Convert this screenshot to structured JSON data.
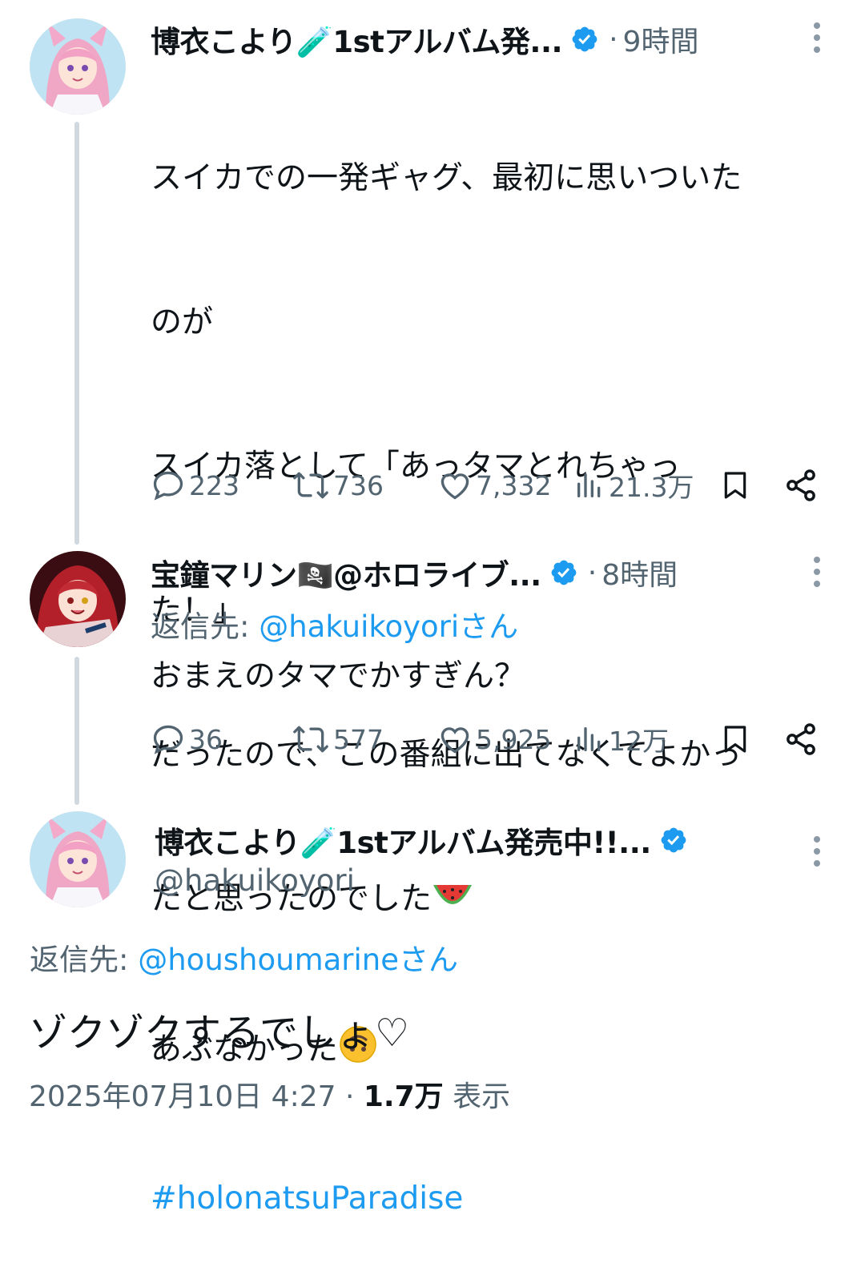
{
  "tweet1": {
    "name": "博衣こより🧪1stアルバム発...",
    "time": "9時間",
    "lines": [
      "スイカでの一発ギャグ、最初に思いついた",
      "のが",
      "スイカ落として「あっタマとれちゃっ",
      "た！」",
      "だったので、この番組に出てなくてよかっ",
      "たと思ったのでした",
      "あぶなかった"
    ],
    "emoji_after_line6": "watermelon-emoji",
    "emoji_after_line7": "upside-down-face-emoji",
    "hashtag": "#holonatsuParadise",
    "replies": "223",
    "retweets": "736",
    "likes": "7,332",
    "views": "21.3万"
  },
  "tweet2": {
    "name": "宝鐘マリン🏴‍☠️@ホロライブ...",
    "time": "8時間",
    "reply_label": "返信先: ",
    "reply_mention": "@hakuikoyori",
    "reply_suffix": "さん",
    "text": "おまえのタマでかすぎん？",
    "replies": "36",
    "retweets": "577",
    "likes": "5,925",
    "views": "12万"
  },
  "tweet3": {
    "name": "博衣こより🧪1stアルバム発売中!!...",
    "handle": "@hakuikoyori",
    "reply_label": "返信先: ",
    "reply_mention": "@houshoumarine",
    "reply_suffix": "さん",
    "text": "ゾクゾクするでしょ♡",
    "date": "2025年07月10日 4:27 · ",
    "views_count": "1.7万",
    "views_label": " 表示"
  },
  "colors": {
    "link": "#1d9bf0",
    "muted": "#536471",
    "verified": "#1d9bf0",
    "thread_line": "#cfd9de"
  }
}
